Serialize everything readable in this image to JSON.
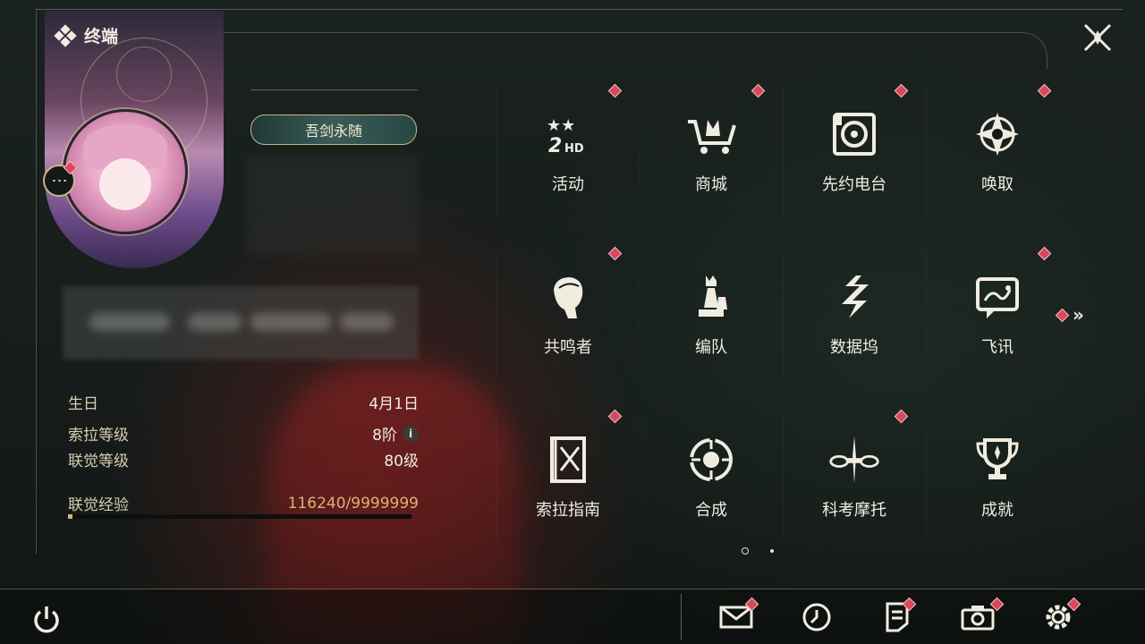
{
  "header": {
    "title": "终端"
  },
  "profile": {
    "title_badge": "吾剑永随",
    "stats": [
      {
        "key": "生日",
        "value": "4月1日"
      },
      {
        "key": "索拉等级",
        "value": "8阶"
      },
      {
        "key": "联觉等级",
        "value": "80级"
      }
    ],
    "exp_label": "联觉经验",
    "exp_value": "116240/9999999",
    "exp_fraction": 0.012
  },
  "menu": [
    {
      "label": "活动",
      "icon": "event-2hd-icon",
      "alert": true
    },
    {
      "label": "商城",
      "icon": "shop-cart-icon",
      "alert": true
    },
    {
      "label": "先约电台",
      "icon": "radio-icon",
      "alert": true
    },
    {
      "label": "唤取",
      "icon": "compass-star-icon",
      "alert": true
    },
    {
      "label": "共鸣者",
      "icon": "resonator-head-icon",
      "alert": true
    },
    {
      "label": "编队",
      "icon": "chess-team-icon",
      "alert": false
    },
    {
      "label": "数据坞",
      "icon": "data-dock-icon",
      "alert": false
    },
    {
      "label": "飞讯",
      "icon": "chat-message-icon",
      "alert": true
    },
    {
      "label": "索拉指南",
      "icon": "guide-book-icon",
      "alert": true
    },
    {
      "label": "合成",
      "icon": "synthesis-icon",
      "alert": false
    },
    {
      "label": "科考摩托",
      "icon": "motorcycle-icon",
      "alert": true
    },
    {
      "label": "成就",
      "icon": "trophy-icon",
      "alert": false
    }
  ],
  "pager": {
    "pages": 2,
    "current": 1
  },
  "bottom_bar": [
    "power-icon",
    "mail-icon",
    "clock-icon",
    "notice-icon",
    "camera-icon",
    "settings-icon"
  ],
  "colors": {
    "accent": "#c9b48a",
    "alert": "#d8485a",
    "text": "#f1ece0"
  }
}
